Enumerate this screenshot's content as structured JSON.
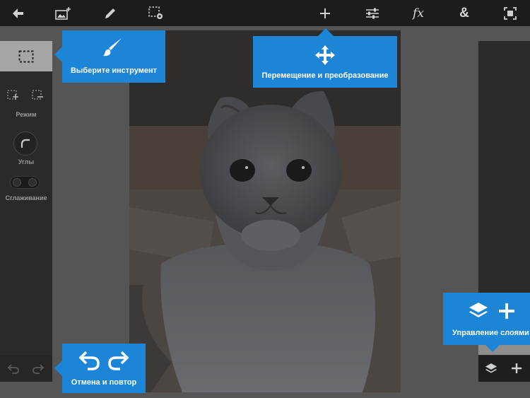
{
  "toolbar": {
    "items": [
      {
        "name": "back",
        "icon": "back-arrow-icon"
      },
      {
        "name": "add-image",
        "icon": "add-image-icon"
      },
      {
        "name": "edit",
        "icon": "pencil-icon"
      },
      {
        "name": "selection-settings",
        "icon": "selection-gear-icon"
      },
      {
        "name": "move-transform",
        "icon": "move-arrows-icon"
      },
      {
        "name": "adjustments",
        "icon": "sliders-icon"
      },
      {
        "name": "effects",
        "icon": "fx-icon",
        "label": "fx"
      },
      {
        "name": "blend",
        "icon": "ampersand-icon",
        "label": "&"
      },
      {
        "name": "fit-screen",
        "icon": "fit-screen-icon"
      }
    ]
  },
  "left_panel": {
    "selected_tool": "rect-select-icon",
    "mode_label": "Режим",
    "corners_label": "Углы",
    "smoothing_label": "Сглаживание"
  },
  "tooltips": {
    "select_tool": "Выберите инструмент",
    "move_transform": "Перемещение и преобразование",
    "undo_redo": "Отмена и повтор",
    "layers": "Управление слоями"
  },
  "right_panel": {
    "layers_icon": "layers-icon",
    "add_icon": "plus-icon"
  },
  "colors": {
    "accent": "#1c85d6",
    "toolbar": "#1c1c1c",
    "panel": "#2a2a2a",
    "canvas": "#555555"
  }
}
